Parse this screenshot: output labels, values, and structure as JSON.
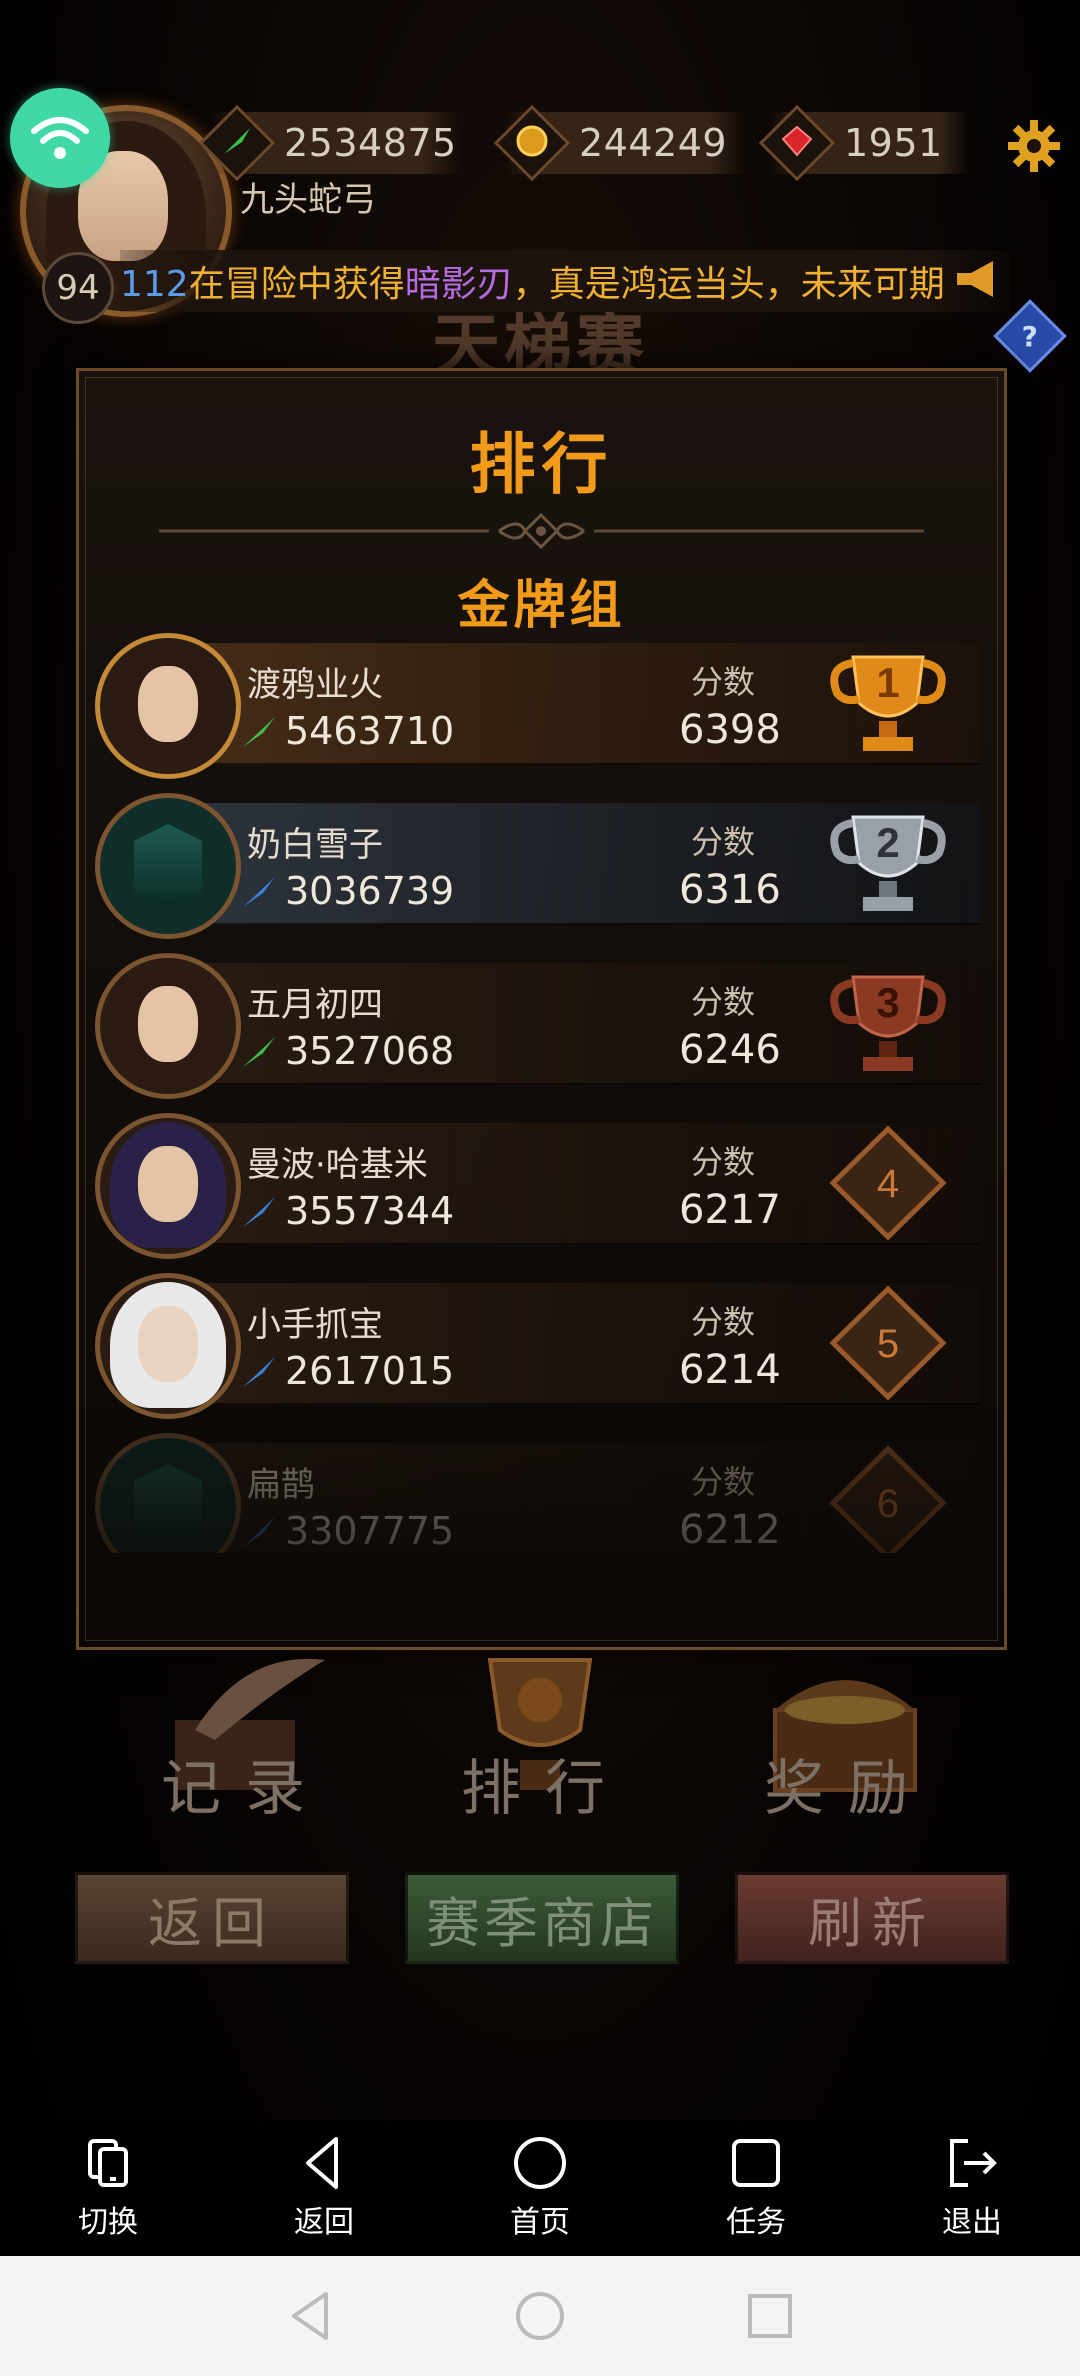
{
  "hud": {
    "level": "94",
    "player_name": "九头蛇弓",
    "power_value": "2534875",
    "gold_value": "244249",
    "gem_value": "1951",
    "icons": [
      "wifi-icon",
      "power-feather-icon",
      "gold-coin-icon",
      "red-gem-icon",
      "gear-icon",
      "horn-icon",
      "help-icon"
    ]
  },
  "marquee": {
    "user": "112",
    "before_item": "在冒险中获得",
    "item": "暗影刃",
    "after_item": "，真是鸿运当头，未来可期"
  },
  "background_title": "天梯赛",
  "panel": {
    "title": "排行",
    "group": "金牌组",
    "score_label": "分数",
    "rows": [
      {
        "rank": "1",
        "name": "渡鸦业火",
        "power": "5463710",
        "score": "6398",
        "power_icon": "green-feather-icon",
        "badge": "gold-trophy"
      },
      {
        "rank": "2",
        "name": "奶白雪子",
        "power": "3036739",
        "score": "6316",
        "power_icon": "blue-feather-icon",
        "badge": "silver-trophy"
      },
      {
        "rank": "3",
        "name": "五月初四",
        "power": "3527068",
        "score": "6246",
        "power_icon": "green-feather-icon",
        "badge": "bronze-trophy"
      },
      {
        "rank": "4",
        "name": "曼波·哈基米",
        "power": "3557344",
        "score": "6217",
        "power_icon": "blue-feather-icon",
        "badge": "diamond"
      },
      {
        "rank": "5",
        "name": "小手抓宝",
        "power": "2617015",
        "score": "6214",
        "power_icon": "blue-feather-icon",
        "badge": "diamond"
      },
      {
        "rank": "6",
        "name": "扁鹊",
        "power": "3307775",
        "score": "6212",
        "power_icon": "blue-feather-icon",
        "badge": "diamond"
      }
    ]
  },
  "bottom_menu": {
    "record": "记录",
    "ranking": "排行",
    "reward": "奖励"
  },
  "actions": {
    "back": "返回",
    "shop": "赛季商店",
    "refresh": "刷新"
  },
  "assistant_bar": {
    "switch": "切换",
    "back": "返回",
    "home": "首页",
    "task": "任务",
    "exit": "退出"
  },
  "colors": {
    "accent_orange": "#f29a1a",
    "marquee_gold": "#f0b030",
    "marquee_user": "#5a9be8",
    "marquee_item": "#b66be0",
    "wifi_green": "#3fd8a6"
  }
}
